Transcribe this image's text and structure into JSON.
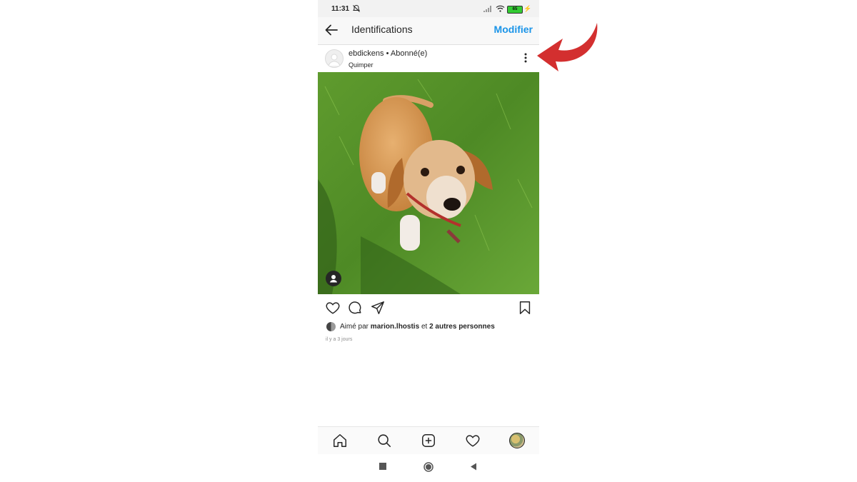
{
  "status_bar": {
    "time": "11:31",
    "battery": "65"
  },
  "header": {
    "title": "Identifications",
    "action": "Modifier"
  },
  "post": {
    "username": "ebdickens",
    "follow_status": "• Abonné(e)",
    "location": "Quimper",
    "likes_prefix": "Aimé par",
    "liked_by": "marion.lhostis",
    "likes_conj": "et",
    "others": "2 autres personnes",
    "time_ago": "il y a 3 jours"
  },
  "icons": {
    "back": "back-arrow-icon",
    "more": "more-vertical-icon",
    "like": "heart-icon",
    "comment": "comment-icon",
    "share": "send-icon",
    "save": "bookmark-icon",
    "home": "home-icon",
    "search": "search-icon",
    "add": "add-post-icon",
    "activity": "heart-icon",
    "tag": "user-tag-icon"
  },
  "colors": {
    "accent": "#1a94e8",
    "annotation_arrow": "#d32f2f"
  }
}
